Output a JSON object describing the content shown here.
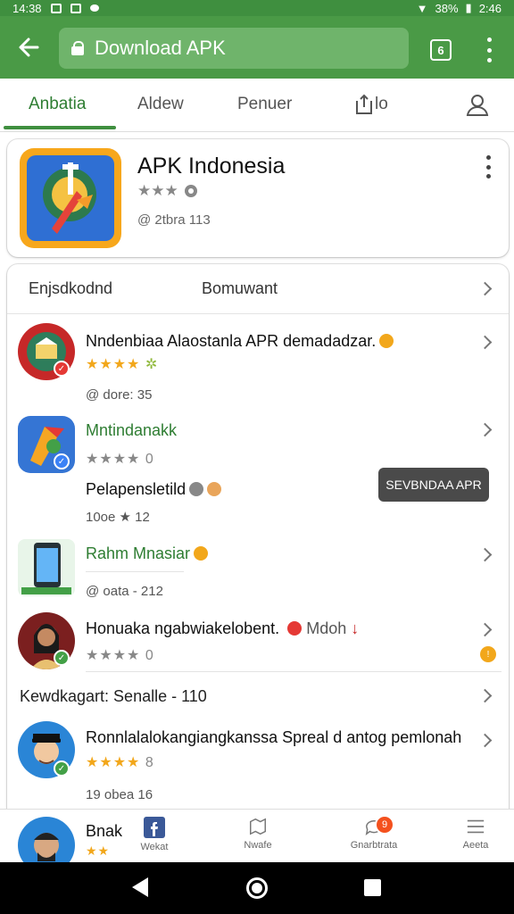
{
  "status_bar": {
    "time_left": "14:38",
    "battery": "38%",
    "time_right": "2:46"
  },
  "browser": {
    "url_text": "Download APK",
    "tab_count": "6"
  },
  "tabs": [
    {
      "label": "Anbatia"
    },
    {
      "label": "Aldew"
    },
    {
      "label": "Penuer"
    },
    {
      "label": "lo"
    }
  ],
  "hero": {
    "title": "APK Indonesia",
    "meta": "@ 2tbra 113"
  },
  "section": {
    "title": "Enjsdkodnd",
    "subtitle": "Bomuwant"
  },
  "items": [
    {
      "title": "Nndenbiaa Alaostanla APR demadadzar.",
      "meta": "@ dore: 35"
    },
    {
      "title": "Mntindanakk",
      "rating": "0",
      "subtitle": "Pelapensletild",
      "meta": "10oe ★ 12",
      "button": "SEVBNDAA APR"
    },
    {
      "title": "Rahm Mnasiar",
      "meta": "@ oata - 212"
    },
    {
      "title": "Honuaka ngabwiakelobent.",
      "title_extra": "Mdoh",
      "rating": "0"
    },
    {
      "title": "Kewdkagart: Senalle - 110"
    },
    {
      "title": "Ronnlalalokangiangkanssa Spreal d antog pemlonah",
      "rating": "8",
      "meta": "19 obea 16"
    },
    {
      "title": "Bnak"
    }
  ],
  "bottom_nav": [
    {
      "label": "Wekat"
    },
    {
      "label": "Nwafe"
    },
    {
      "label": "Gnarbtrata",
      "badge": "9"
    },
    {
      "label": "Aeeta"
    }
  ],
  "colors": {
    "primary": "#4a9a46",
    "primary_dark": "#3f8f3f",
    "accent_text": "#2e7d32",
    "star_gold": "#f2a71b"
  }
}
